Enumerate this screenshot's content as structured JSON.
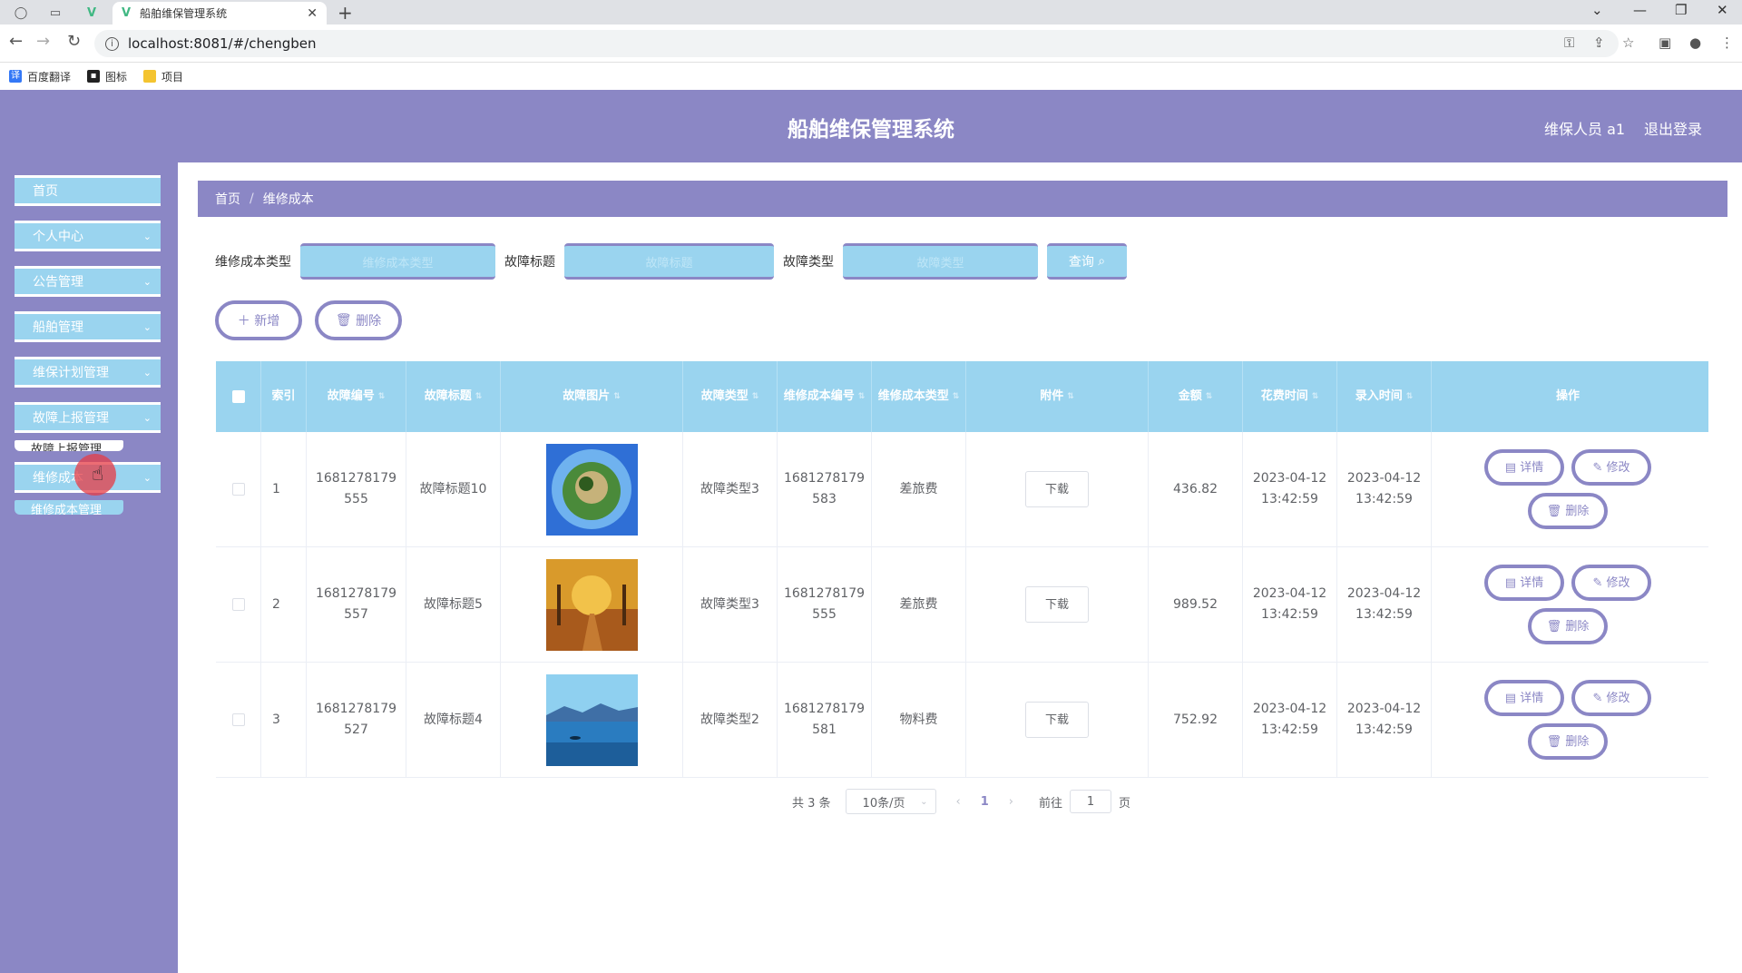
{
  "browser": {
    "tab_title": "船舶维保管理系统",
    "url": "localhost:8081/#/chengben",
    "bookmarks": [
      "百度翻译",
      "图标",
      "项目"
    ]
  },
  "header": {
    "title": "船舶维保管理系统",
    "user": "维保人员 a1",
    "logout": "退出登录"
  },
  "sidebar": {
    "items": [
      {
        "label": "首页"
      },
      {
        "label": "个人中心"
      },
      {
        "label": "公告管理"
      },
      {
        "label": "船舶管理"
      },
      {
        "label": "维保计划管理"
      },
      {
        "label": "故障上报管理"
      },
      {
        "label": "维修成本"
      }
    ],
    "sub_overlap": "故障上报管理",
    "sub_active": "维修成本管理"
  },
  "breadcrumb": {
    "home": "首页",
    "sep": "/",
    "current": "维修成本"
  },
  "search": {
    "label1": "维修成本类型",
    "placeholder1": "维修成本类型",
    "label2": "故障标题",
    "placeholder2": "故障标题",
    "label3": "故障类型",
    "placeholder3": "故障类型",
    "query": "查询"
  },
  "actions": {
    "add": "新增",
    "delete": "删除"
  },
  "table": {
    "headers": [
      "索引",
      "故障编号",
      "故障标题",
      "故障图片",
      "故障类型",
      "维修成本编号",
      "维修成本类型",
      "附件",
      "金额",
      "花费时间",
      "录入时间",
      "操作"
    ],
    "rows": [
      {
        "index": "1",
        "fault_no_1": "1681278179",
        "fault_no_2": "555",
        "title": "故障标题10",
        "type": "故障类型3",
        "cost_no_1": "1681278179",
        "cost_no_2": "583",
        "cost_type": "差旅费",
        "attach": "下载",
        "amount": "436.82",
        "spend_date": "2023-04-12",
        "spend_time": "13:42:59",
        "entry_date": "2023-04-12",
        "entry_time": "13:42:59"
      },
      {
        "index": "2",
        "fault_no_1": "1681278179",
        "fault_no_2": "557",
        "title": "故障标题5",
        "type": "故障类型3",
        "cost_no_1": "1681278179",
        "cost_no_2": "555",
        "cost_type": "差旅费",
        "attach": "下载",
        "amount": "989.52",
        "spend_date": "2023-04-12",
        "spend_time": "13:42:59",
        "entry_date": "2023-04-12",
        "entry_time": "13:42:59"
      },
      {
        "index": "3",
        "fault_no_1": "1681278179",
        "fault_no_2": "527",
        "title": "故障标题4",
        "type": "故障类型2",
        "cost_no_1": "1681278179",
        "cost_no_2": "581",
        "cost_type": "物料费",
        "attach": "下载",
        "amount": "752.92",
        "spend_date": "2023-04-12",
        "spend_time": "13:42:59",
        "entry_date": "2023-04-12",
        "entry_time": "13:42:59"
      }
    ],
    "op_detail": "详情",
    "op_edit": "修改",
    "op_delete": "删除"
  },
  "pagination": {
    "total": "共 3 条",
    "page_size": "10条/页",
    "current": "1",
    "goto": "前往",
    "goto_value": "1",
    "page_unit": "页"
  },
  "colors": {
    "primary": "#8b87c5",
    "accent": "#9ad4ef"
  }
}
